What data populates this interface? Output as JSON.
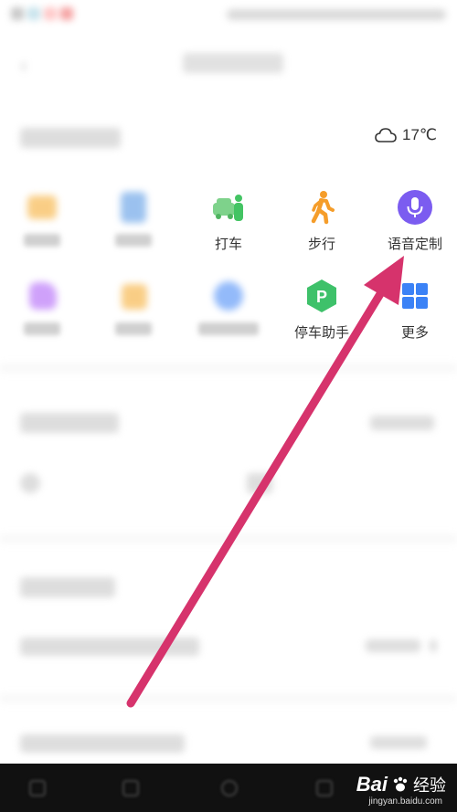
{
  "weather": {
    "icon": "cloud-icon",
    "temperature": "17℃"
  },
  "tools": [
    {
      "label": "",
      "icon": "taxi-icon",
      "color": "#f5a623"
    },
    {
      "label": "",
      "icon": "bus-icon",
      "color": "#4a90e2"
    },
    {
      "label": "打车",
      "icon": "car-icon",
      "color": "#43c463"
    },
    {
      "label": "步行",
      "icon": "walk-icon",
      "color": "#f59d2a"
    },
    {
      "label": "语音定制",
      "icon": "microphone-icon",
      "color": "#8b5cf6"
    },
    {
      "label": "",
      "icon": "ticket-icon",
      "color": "#a855f7"
    },
    {
      "label": "",
      "icon": "bag-icon",
      "color": "#f5a623"
    },
    {
      "label": "",
      "icon": "chat-icon",
      "color": "#3b82f6"
    },
    {
      "label": "停车助手",
      "icon": "parking-icon",
      "color": "#43c463"
    },
    {
      "label": "更多",
      "icon": "grid-icon",
      "color": "#3b82f6"
    }
  ],
  "watermark": {
    "brand": "Bai",
    "text": "经验",
    "url": "jingyan.baidu.com"
  },
  "annotation": {
    "color": "#d6336c"
  }
}
